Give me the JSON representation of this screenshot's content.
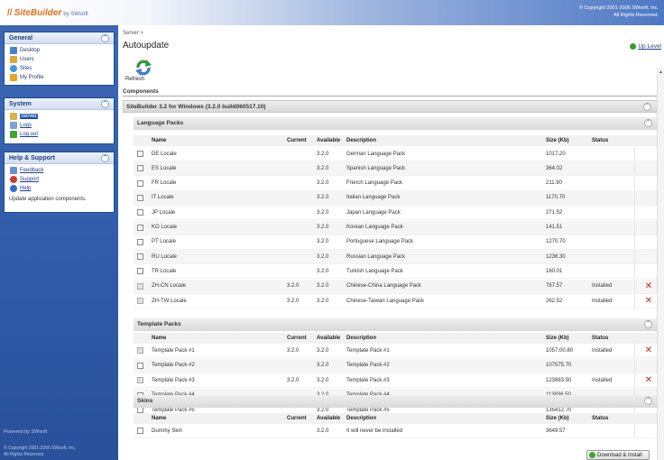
{
  "app": {
    "brand": "SiteBuilder",
    "by": "by SWsoft",
    "copyright_lines": [
      "© Copyright 2001-2006 SWsoft, Inc.",
      "All Rights Reserved."
    ]
  },
  "sidebar": {
    "general": {
      "title": "General",
      "items": [
        {
          "label": "Desktop",
          "icon": "desktop-icon",
          "color": "#4a7fcf"
        },
        {
          "label": "Users",
          "icon": "users-icon",
          "color": "#d8a93a"
        },
        {
          "label": "Sites",
          "icon": "sites-icon",
          "color": "#3d9ad6"
        },
        {
          "label": "My Profile",
          "icon": "profile-icon",
          "color": "#e6a52a"
        }
      ]
    },
    "system": {
      "title": "System",
      "items": [
        {
          "label": "Server",
          "icon": "server-icon",
          "color": "#d9b24a"
        },
        {
          "label": "Logs",
          "icon": "logs-icon",
          "color": "#7fa3d8"
        },
        {
          "label": "Log out",
          "icon": "logout-icon",
          "color": "#3fa530"
        }
      ]
    },
    "help": {
      "title": "Help & Support",
      "items": [
        {
          "label": "Feedback",
          "icon": "feedback-icon",
          "color": "#6a8fcf"
        },
        {
          "label": "Support",
          "icon": "support-icon",
          "color": "#cc3c2a"
        },
        {
          "label": "Help",
          "icon": "help-icon",
          "color": "#2f6cc9"
        }
      ],
      "hint": "Update application components."
    },
    "footer": {
      "powered": "Powered by SWsoft",
      "copyright_lines": [
        "© Copyright 2001-2006 SWsoft, Inc.",
        "All Rights Reserved."
      ]
    }
  },
  "main": {
    "breadcrumb": "Server >",
    "title": "Autoupdate",
    "up_level": "Up Level",
    "refresh_label": "Refresh",
    "components_label": "Components",
    "product_header": "SiteBuilder 3.2 for Windows (3.2.0 build060517.10)",
    "columns": {
      "name": "Name",
      "current": "Current",
      "available": "Available",
      "description": "Description",
      "size": "Size (Kb)",
      "status": "Status"
    },
    "language_packs": {
      "title": "Language Packs",
      "rows": [
        {
          "name": "DE Locale",
          "current": "",
          "available": "3.2.0",
          "description": "German Language Pack",
          "size": "1017.20",
          "status": "",
          "installed": false
        },
        {
          "name": "ES Locale",
          "current": "",
          "available": "3.2.0",
          "description": "Spanish Language Pack",
          "size": "364.02",
          "status": "",
          "installed": false
        },
        {
          "name": "FR Locale",
          "current": "",
          "available": "3.2.0",
          "description": "French Language Pack",
          "size": "211.90",
          "status": "",
          "installed": false
        },
        {
          "name": "IT Locale",
          "current": "",
          "available": "3.2.0",
          "description": "Italian Language Pack",
          "size": "1170.70",
          "status": "",
          "installed": false
        },
        {
          "name": "JP Locale",
          "current": "",
          "available": "3.2.0",
          "description": "Japan Language Pack",
          "size": "271.52",
          "status": "",
          "installed": false
        },
        {
          "name": "KO Locale",
          "current": "",
          "available": "3.2.0",
          "description": "Korean Language Pack",
          "size": "141.51",
          "status": "",
          "installed": false
        },
        {
          "name": "PT Locale",
          "current": "",
          "available": "3.2.0",
          "description": "Portuguese Language Pack",
          "size": "1270.70",
          "status": "",
          "installed": false
        },
        {
          "name": "RU Locale",
          "current": "",
          "available": "3.2.0",
          "description": "Russian Language Pack",
          "size": "1236.30",
          "status": "",
          "installed": false
        },
        {
          "name": "TR Locale",
          "current": "",
          "available": "3.2.0",
          "description": "Turkish Language Pack",
          "size": "160.01",
          "status": "",
          "installed": false
        },
        {
          "name": "ZH-CN Locale",
          "current": "3.2.0",
          "available": "3.2.0",
          "description": "Chinese-China Language Pack",
          "size": "767.57",
          "status": "Installed",
          "installed": true
        },
        {
          "name": "ZH-TW Locale",
          "current": "3.2.0",
          "available": "3.2.0",
          "description": "Chinese-Taiwan Language Pack",
          "size": "262.52",
          "status": "Installed",
          "installed": true
        }
      ]
    },
    "template_packs": {
      "title": "Template Packs",
      "rows": [
        {
          "name": "Template Pack #1",
          "current": "3.2.0",
          "available": "3.2.0",
          "description": "Template Pack #1",
          "size": "1057.00.80",
          "status": "Installed",
          "installed": true
        },
        {
          "name": "Template Pack #2",
          "current": "",
          "available": "3.2.0",
          "description": "Template Pack #2",
          "size": "107575.70",
          "status": "",
          "installed": false
        },
        {
          "name": "Template Pack #3",
          "current": "3.2.0",
          "available": "3.2.0",
          "description": "Template Pack #3",
          "size": "123883.50",
          "status": "Installed",
          "installed": true
        },
        {
          "name": "Template Pack #4",
          "current": "",
          "available": "3.2.0",
          "description": "Template Pack #4",
          "size": "113836.50",
          "status": "",
          "installed": false
        },
        {
          "name": "Template Pack #5",
          "current": "",
          "available": "3.2.0",
          "description": "Template Pack #5",
          "size": "135412.70",
          "status": "",
          "installed": false
        }
      ]
    },
    "skins": {
      "title": "Skins",
      "rows": [
        {
          "name": "Dummy Skin",
          "current": "",
          "available": "3.2.0",
          "description": "It will never be installed",
          "size": "3649.57",
          "status": "",
          "installed": false
        }
      ]
    },
    "install_button": "Download & Install"
  }
}
